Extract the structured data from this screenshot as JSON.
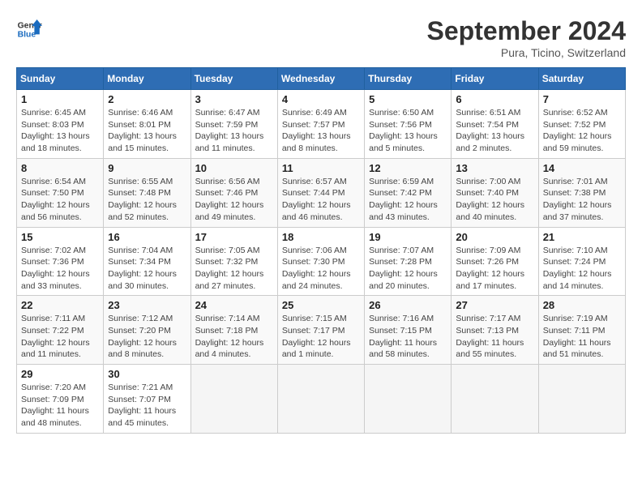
{
  "logo": {
    "line1": "General",
    "line2": "Blue"
  },
  "title": "September 2024",
  "location": "Pura, Ticino, Switzerland",
  "days_header": [
    "Sunday",
    "Monday",
    "Tuesday",
    "Wednesday",
    "Thursday",
    "Friday",
    "Saturday"
  ],
  "weeks": [
    [
      {
        "day": "1",
        "info": "Sunrise: 6:45 AM\nSunset: 8:03 PM\nDaylight: 13 hours\nand 18 minutes."
      },
      {
        "day": "2",
        "info": "Sunrise: 6:46 AM\nSunset: 8:01 PM\nDaylight: 13 hours\nand 15 minutes."
      },
      {
        "day": "3",
        "info": "Sunrise: 6:47 AM\nSunset: 7:59 PM\nDaylight: 13 hours\nand 11 minutes."
      },
      {
        "day": "4",
        "info": "Sunrise: 6:49 AM\nSunset: 7:57 PM\nDaylight: 13 hours\nand 8 minutes."
      },
      {
        "day": "5",
        "info": "Sunrise: 6:50 AM\nSunset: 7:56 PM\nDaylight: 13 hours\nand 5 minutes."
      },
      {
        "day": "6",
        "info": "Sunrise: 6:51 AM\nSunset: 7:54 PM\nDaylight: 13 hours\nand 2 minutes."
      },
      {
        "day": "7",
        "info": "Sunrise: 6:52 AM\nSunset: 7:52 PM\nDaylight: 12 hours\nand 59 minutes."
      }
    ],
    [
      {
        "day": "8",
        "info": "Sunrise: 6:54 AM\nSunset: 7:50 PM\nDaylight: 12 hours\nand 56 minutes."
      },
      {
        "day": "9",
        "info": "Sunrise: 6:55 AM\nSunset: 7:48 PM\nDaylight: 12 hours\nand 52 minutes."
      },
      {
        "day": "10",
        "info": "Sunrise: 6:56 AM\nSunset: 7:46 PM\nDaylight: 12 hours\nand 49 minutes."
      },
      {
        "day": "11",
        "info": "Sunrise: 6:57 AM\nSunset: 7:44 PM\nDaylight: 12 hours\nand 46 minutes."
      },
      {
        "day": "12",
        "info": "Sunrise: 6:59 AM\nSunset: 7:42 PM\nDaylight: 12 hours\nand 43 minutes."
      },
      {
        "day": "13",
        "info": "Sunrise: 7:00 AM\nSunset: 7:40 PM\nDaylight: 12 hours\nand 40 minutes."
      },
      {
        "day": "14",
        "info": "Sunrise: 7:01 AM\nSunset: 7:38 PM\nDaylight: 12 hours\nand 37 minutes."
      }
    ],
    [
      {
        "day": "15",
        "info": "Sunrise: 7:02 AM\nSunset: 7:36 PM\nDaylight: 12 hours\nand 33 minutes."
      },
      {
        "day": "16",
        "info": "Sunrise: 7:04 AM\nSunset: 7:34 PM\nDaylight: 12 hours\nand 30 minutes."
      },
      {
        "day": "17",
        "info": "Sunrise: 7:05 AM\nSunset: 7:32 PM\nDaylight: 12 hours\nand 27 minutes."
      },
      {
        "day": "18",
        "info": "Sunrise: 7:06 AM\nSunset: 7:30 PM\nDaylight: 12 hours\nand 24 minutes."
      },
      {
        "day": "19",
        "info": "Sunrise: 7:07 AM\nSunset: 7:28 PM\nDaylight: 12 hours\nand 20 minutes."
      },
      {
        "day": "20",
        "info": "Sunrise: 7:09 AM\nSunset: 7:26 PM\nDaylight: 12 hours\nand 17 minutes."
      },
      {
        "day": "21",
        "info": "Sunrise: 7:10 AM\nSunset: 7:24 PM\nDaylight: 12 hours\nand 14 minutes."
      }
    ],
    [
      {
        "day": "22",
        "info": "Sunrise: 7:11 AM\nSunset: 7:22 PM\nDaylight: 12 hours\nand 11 minutes."
      },
      {
        "day": "23",
        "info": "Sunrise: 7:12 AM\nSunset: 7:20 PM\nDaylight: 12 hours\nand 8 minutes."
      },
      {
        "day": "24",
        "info": "Sunrise: 7:14 AM\nSunset: 7:18 PM\nDaylight: 12 hours\nand 4 minutes."
      },
      {
        "day": "25",
        "info": "Sunrise: 7:15 AM\nSunset: 7:17 PM\nDaylight: 12 hours\nand 1 minute."
      },
      {
        "day": "26",
        "info": "Sunrise: 7:16 AM\nSunset: 7:15 PM\nDaylight: 11 hours\nand 58 minutes."
      },
      {
        "day": "27",
        "info": "Sunrise: 7:17 AM\nSunset: 7:13 PM\nDaylight: 11 hours\nand 55 minutes."
      },
      {
        "day": "28",
        "info": "Sunrise: 7:19 AM\nSunset: 7:11 PM\nDaylight: 11 hours\nand 51 minutes."
      }
    ],
    [
      {
        "day": "29",
        "info": "Sunrise: 7:20 AM\nSunset: 7:09 PM\nDaylight: 11 hours\nand 48 minutes."
      },
      {
        "day": "30",
        "info": "Sunrise: 7:21 AM\nSunset: 7:07 PM\nDaylight: 11 hours\nand 45 minutes."
      },
      {
        "day": "",
        "info": ""
      },
      {
        "day": "",
        "info": ""
      },
      {
        "day": "",
        "info": ""
      },
      {
        "day": "",
        "info": ""
      },
      {
        "day": "",
        "info": ""
      }
    ]
  ]
}
